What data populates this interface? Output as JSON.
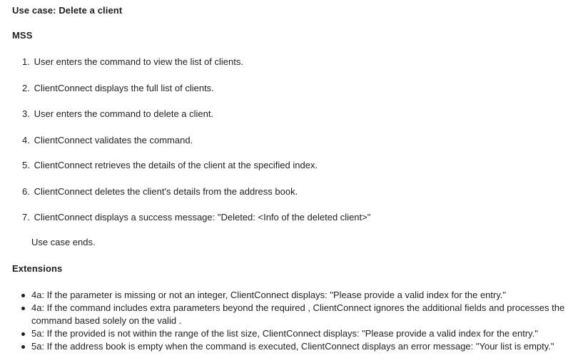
{
  "use_case_title": "Use case: Delete a client",
  "mss_heading": "MSS",
  "steps": [
    {
      "num": "1.",
      "text": "User enters the command to view the list of clients."
    },
    {
      "num": "2.",
      "text": "ClientConnect displays the full list of clients."
    },
    {
      "num": "3.",
      "text": "User enters the command to delete a client."
    },
    {
      "num": "4.",
      "text": "ClientConnect validates the command."
    },
    {
      "num": "5.",
      "text": "ClientConnect retrieves the details of the client at the specified index."
    },
    {
      "num": "6.",
      "text": "ClientConnect deletes the client's details from the address book."
    },
    {
      "num": "7.",
      "text": "ClientConnect displays a success message: \"Deleted: <Info of the deleted client>\""
    }
  ],
  "use_case_ends": "Use case ends.",
  "extensions_heading": "Extensions",
  "extensions": [
    "4a: If the parameter is missing or not an integer, ClientConnect displays: \"Please provide a valid index for the entry.\"",
    "4a: If the command includes extra parameters beyond the required , ClientConnect ignores the additional fields and processes the command based solely on the valid .",
    "5a: If the provided is not within the range of the list size, ClientConnect displays: \"Please provide a valid index for the entry.\"",
    "5a: If the address book is empty when the command is executed, ClientConnect displays an error message: \"Your list is empty.\""
  ]
}
